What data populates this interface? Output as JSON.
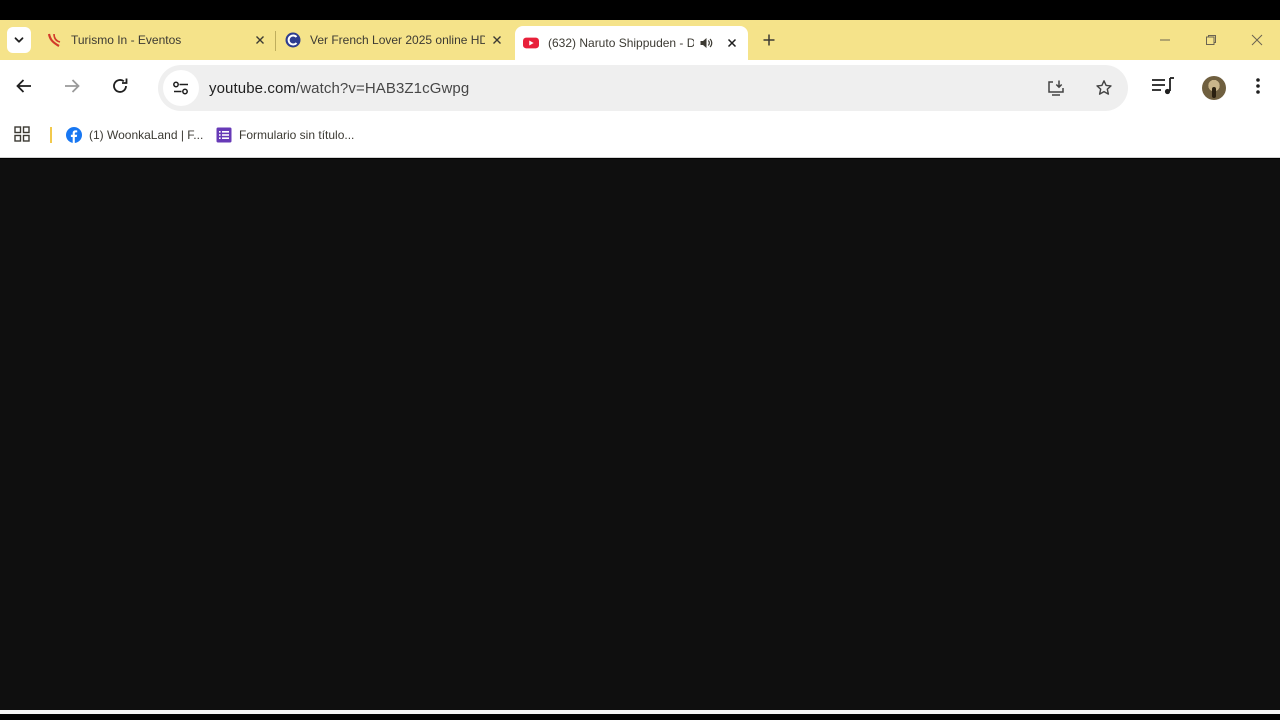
{
  "tabs": [
    {
      "title": "Turismo In - Eventos",
      "icon": "turismo-favicon",
      "active": false
    },
    {
      "title": "Ver French Lover 2025 online HD",
      "icon": "site-favicon",
      "active": false
    },
    {
      "title": "(632) Naruto Shippuden - D",
      "icon": "youtube-favicon",
      "active": true,
      "audio": true
    }
  ],
  "toolbar": {
    "url_domain": "youtube.com",
    "url_path": "/watch?v=HAB3Z1cGwpg"
  },
  "bookmarks": [
    {
      "label": "(1) WoonkaLand | F...",
      "icon": "facebook-icon"
    },
    {
      "label": "Formulario sin título...",
      "icon": "google-forms-icon"
    }
  ],
  "colors": {
    "tabstrip": "#f5e38a",
    "content_bg": "#0f0f0f",
    "youtube_red": "#e8203a",
    "facebook_blue": "#1877f2",
    "forms_purple": "#673ab7"
  }
}
